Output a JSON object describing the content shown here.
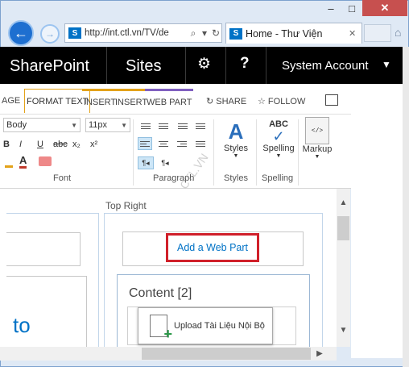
{
  "window": {
    "minimize": "–",
    "maximize": "□",
    "close": "✕"
  },
  "browser": {
    "address": "http://int.ctl.vn/TV/de",
    "search_btn": "⌕",
    "refresh_btn": "↻",
    "tab_title": "Home - Thư Viện",
    "tab_close": "✕",
    "site_icon": "S"
  },
  "suitebar": {
    "brand": "SharePoint",
    "sites": "Sites",
    "account": "System Account",
    "help": "?"
  },
  "ribbon_tabs": {
    "page": "AGE",
    "format_text": "FORMAT TEXT",
    "insert1": "INSERT",
    "insert2": "INSERT",
    "web_part": "WEB PART",
    "share": "SHARE",
    "follow": "FOLLOW"
  },
  "font_group": {
    "font_value": "Body",
    "size_value": "11px",
    "bold": "B",
    "italic": "I",
    "underline": "U",
    "strike": "abc",
    "sub": "x₂",
    "sup": "x²",
    "label": "Font"
  },
  "paragraph_group": {
    "label": "Paragraph",
    "ltr": "¶◂",
    "rtl": "¶◂"
  },
  "styles_group": {
    "button": "Styles",
    "label": "Styles"
  },
  "spelling_group": {
    "icon_text": "ABC",
    "button": "Spelling",
    "label": "Spelling"
  },
  "markup_group": {
    "button": "Markup"
  },
  "page": {
    "zone_label": "Top Right",
    "add_web_part": "Add a Web Part",
    "content_title": "Content [2]",
    "upload_label": "Upload Tài Liệu Nội Bộ",
    "left_text": "to"
  },
  "watermark": "CTL.VN",
  "colors": {
    "suitebar": "#000000",
    "accent": "#0072c6",
    "highlight": "#d0202a"
  }
}
